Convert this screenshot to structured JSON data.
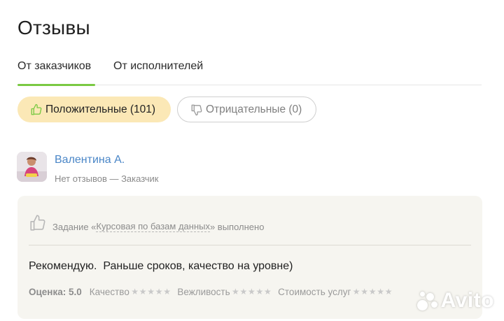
{
  "page": {
    "title": "Отзывы"
  },
  "tabs": [
    {
      "label": "От заказчиков",
      "active": true
    },
    {
      "label": "От исполнителей",
      "active": false
    }
  ],
  "filters": {
    "positive": {
      "label": "Положительные (101)",
      "icon": "thumbs-up-icon"
    },
    "negative": {
      "label": "Отрицательные (0)",
      "icon": "thumbs-down-icon"
    }
  },
  "review": {
    "reviewer_name": "Валентина А.",
    "reviewer_meta": "Нет отзывов — Заказчик",
    "task_prefix": "Задание «",
    "task_title": "Курсовая по базам данных",
    "task_suffix": "» выполнено",
    "text": "Рекомендую.  Раньше сроков, качество на уровне)",
    "score_label": "Оценка: 5.0",
    "ratings": [
      {
        "label": "Качество",
        "stars": 5
      },
      {
        "label": "Вежливость",
        "stars": 5
      },
      {
        "label": "Стоимость услуг",
        "stars": 5
      }
    ]
  },
  "watermark": {
    "text": "Avito"
  },
  "colors": {
    "accent_green": "#7ac943",
    "link_blue": "#4a86c7",
    "positive_bg": "#fbe8b6",
    "card_bg": "#f6f5f0"
  }
}
